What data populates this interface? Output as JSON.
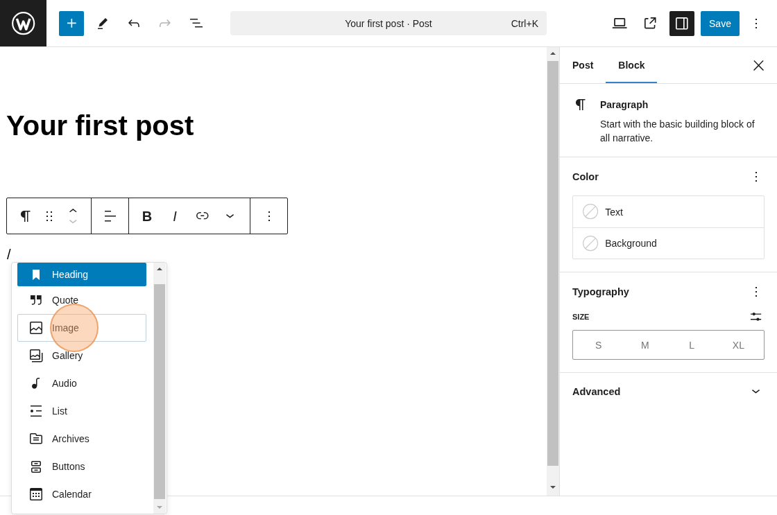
{
  "top_bar": {
    "undo": {
      "disabled": false
    },
    "redo": {
      "disabled": true
    },
    "command_bar": {
      "title": "Your first post · Post",
      "shortcut": "Ctrl+K"
    },
    "settings_toggle": {
      "on": true
    },
    "save_button": {
      "label": "Save"
    }
  },
  "editor": {
    "title": "Your first post",
    "paragraph": "/"
  },
  "block_toolbar": {
    "move_up": {
      "disabled": false
    },
    "move_down": {
      "disabled": true
    },
    "bold": {
      "label": "B"
    },
    "italic": {
      "label": "I"
    }
  },
  "inserter": {
    "items": [
      {
        "kind": "heading",
        "label": "Heading",
        "selected": true,
        "hovered": false,
        "clicked": false
      },
      {
        "kind": "quote",
        "label": "Quote",
        "selected": false,
        "hovered": false,
        "clicked": false
      },
      {
        "kind": "image",
        "label": "Image",
        "selected": false,
        "hovered": true,
        "clicked": true
      },
      {
        "kind": "gallery",
        "label": "Gallery",
        "selected": false,
        "hovered": false,
        "clicked": false
      },
      {
        "kind": "audio",
        "label": "Audio",
        "selected": false,
        "hovered": false,
        "clicked": false
      },
      {
        "kind": "list",
        "label": "List",
        "selected": false,
        "hovered": false,
        "clicked": false
      },
      {
        "kind": "archives",
        "label": "Archives",
        "selected": false,
        "hovered": false,
        "clicked": false
      },
      {
        "kind": "buttons",
        "label": "Buttons",
        "selected": false,
        "hovered": false,
        "clicked": false
      },
      {
        "kind": "calendar",
        "label": "Calendar",
        "selected": false,
        "hovered": false,
        "clicked": false
      }
    ]
  },
  "sidebar": {
    "tabs": [
      {
        "label": "Post",
        "selected": false
      },
      {
        "label": "Block",
        "selected": true
      }
    ],
    "block_card": {
      "title": "Paragraph",
      "description": "Start with the basic building block of all narrative."
    },
    "color": {
      "title": "Color",
      "items": [
        {
          "label": "Text"
        },
        {
          "label": "Background"
        }
      ]
    },
    "typography": {
      "title": "Typography",
      "size_label": "SIZE",
      "sizes": [
        {
          "label": "S",
          "selected": false
        },
        {
          "label": "M",
          "selected": false
        },
        {
          "label": "L",
          "selected": false
        },
        {
          "label": "XL",
          "selected": false
        }
      ]
    },
    "advanced": {
      "title": "Advanced",
      "expanded": false
    }
  }
}
